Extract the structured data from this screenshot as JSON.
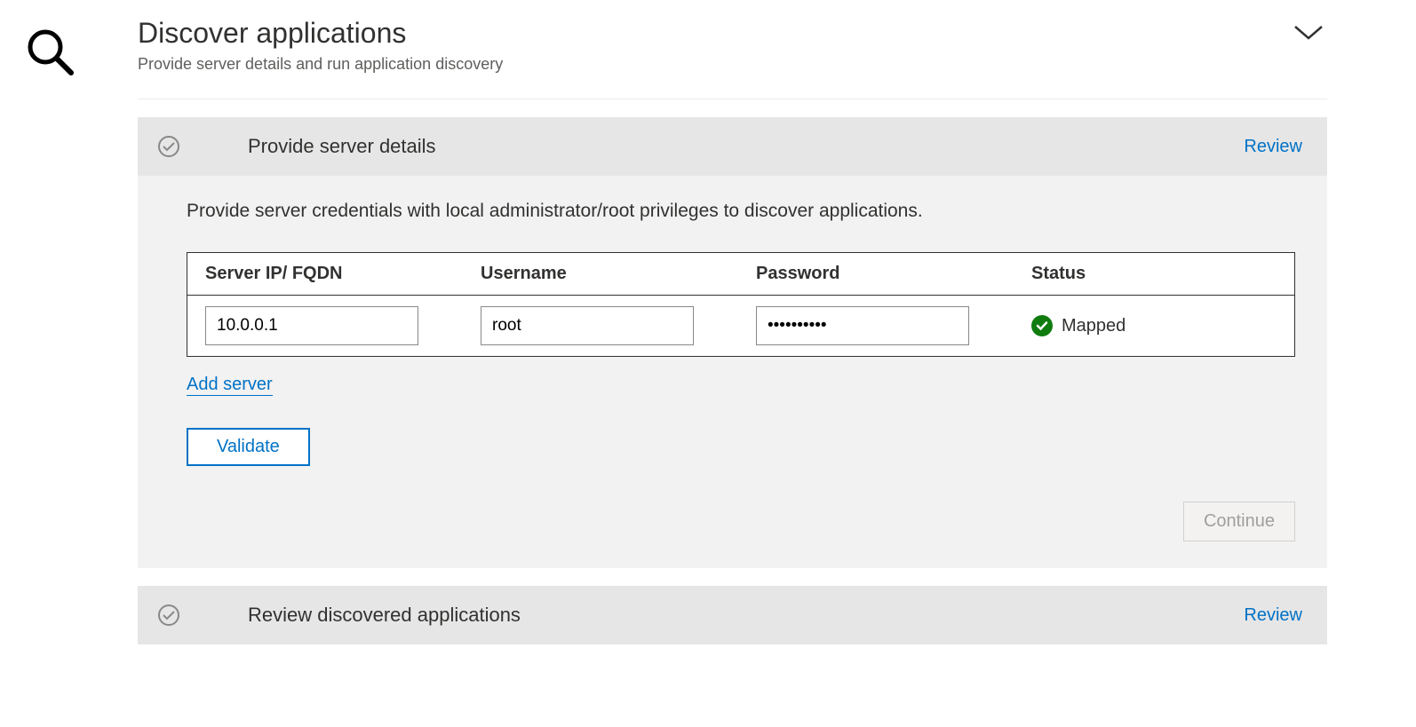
{
  "page": {
    "title": "Discover applications",
    "subtitle": "Provide server details and run application discovery"
  },
  "step1": {
    "title": "Provide server details",
    "review_label": "Review",
    "instructions": "Provide server credentials with local administrator/root privileges to discover applications.",
    "columns": {
      "ip": "Server IP/ FQDN",
      "username": "Username",
      "password": "Password",
      "status": "Status"
    },
    "row": {
      "ip_value": "10.0.0.1",
      "username_value": "root",
      "password_value": "••••••••••",
      "status_text": "Mapped"
    },
    "add_server_label": "Add server",
    "validate_label": "Validate",
    "continue_label": "Continue"
  },
  "step2": {
    "title": "Review discovered applications",
    "review_label": "Review"
  }
}
